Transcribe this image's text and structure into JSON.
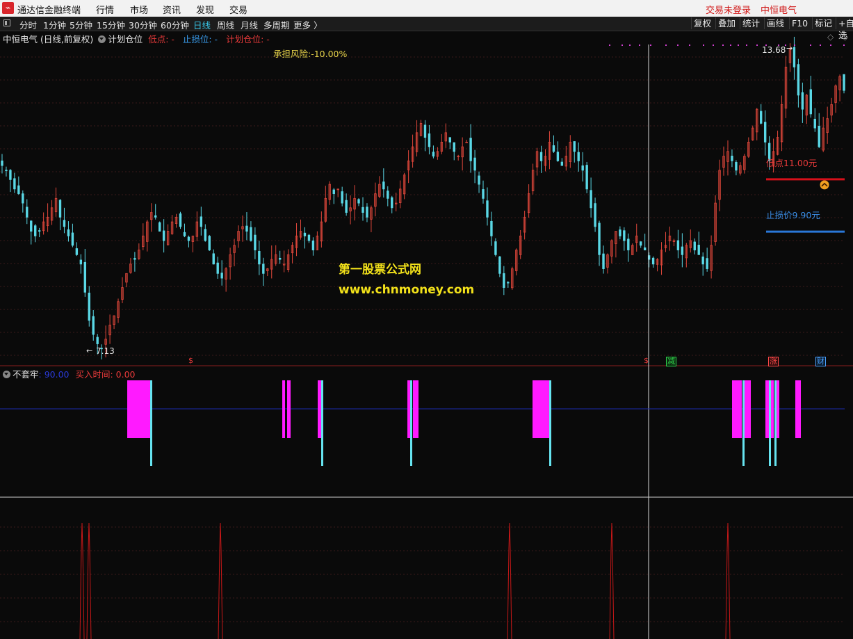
{
  "app": {
    "title": "通达信金融终端",
    "logo_icon": "tdx-logo-icon"
  },
  "menu": [
    "行情",
    "市场",
    "资讯",
    "发现",
    "交易"
  ],
  "menu_right": {
    "login_status": "交易未登录",
    "stock_name": "中恒电气"
  },
  "toolbar": {
    "periods": [
      "分时",
      "1分钟",
      "5分钟",
      "15分钟",
      "30分钟",
      "60分钟",
      "日线",
      "周线",
      "月线",
      "多周期",
      "更多 〉"
    ],
    "active_period": "日线",
    "right_buttons": [
      "复权",
      "叠加",
      "统计",
      "画线",
      "F10",
      "标记",
      "+自选"
    ]
  },
  "main_panel": {
    "title": "中恒电气 (日线,前复权)",
    "indicator": "计划仓位",
    "low_label": "低点: -",
    "stop_label": "止损位: -",
    "plan_label": "计划仓位: -",
    "risk_text": "承担风险:-10.00%",
    "low_marker": "低点11.00元",
    "stop_marker": "止损价9.90元",
    "high_price": "13.68",
    "low_price": "7.13",
    "watermark_name": "第一股票公式网",
    "watermark_url": "www.chnmoney.com",
    "markers": [
      "$",
      "$",
      "减",
      "涨",
      "财"
    ]
  },
  "sub_panel": {
    "indicator": "不套牢",
    "value_label": ": 90.00",
    "buy_label": "买入时间: 0.00"
  },
  "colors": {
    "up": "#e0473b",
    "down": "#5ad8e6",
    "magenta": "#ff1aff",
    "cyan_bar": "#66e4f0",
    "red_line": "#d8101a",
    "blue_line": "#2a78d8"
  },
  "chart_data": {
    "type": "candlestick",
    "price_range": [
      7.13,
      13.68
    ],
    "close_series": [
      11.1,
      11.0,
      10.8,
      10.6,
      10.5,
      10.3,
      10.0,
      9.7,
      9.6,
      9.7,
      9.9,
      10.0,
      10.2,
      10.4,
      10.0,
      9.8,
      9.6,
      9.4,
      9.2,
      9.0,
      8.4,
      7.8,
      7.5,
      7.3,
      7.2,
      7.4,
      7.7,
      7.9,
      8.2,
      8.5,
      8.8,
      9.0,
      9.1,
      9.3,
      9.6,
      9.9,
      10.1,
      10.0,
      9.7,
      9.5,
      9.7,
      9.9,
      10.0,
      9.8,
      9.6,
      9.5,
      9.6,
      9.9,
      9.8,
      9.5,
      9.3,
      9.0,
      8.8,
      8.7,
      8.9,
      9.2,
      9.4,
      9.7,
      9.8,
      9.7,
      9.5,
      9.3,
      9.0,
      8.8,
      8.9,
      9.1,
      9.2,
      9.1,
      9.0,
      9.2,
      9.4,
      9.6,
      9.7,
      9.6,
      9.5,
      9.3,
      9.6,
      9.9,
      10.4,
      10.7,
      10.5,
      10.6,
      10.3,
      10.1,
      10.2,
      10.4,
      10.3,
      10.1,
      10.0,
      10.2,
      10.5,
      10.7,
      10.6,
      10.4,
      10.2,
      10.3,
      10.6,
      10.9,
      11.2,
      11.5,
      11.8,
      12.0,
      11.7,
      11.5,
      11.3,
      11.4,
      11.6,
      11.8,
      11.6,
      11.4,
      11.3,
      11.5,
      11.6,
      11.2,
      11.0,
      10.7,
      10.4,
      10.0,
      9.6,
      9.2,
      8.8,
      8.5,
      8.6,
      8.9,
      9.3,
      9.6,
      10.0,
      10.5,
      11.0,
      11.4,
      11.2,
      11.3,
      11.6,
      11.4,
      11.2,
      11.1,
      11.3,
      11.6,
      11.4,
      11.2,
      11.0,
      10.6,
      10.2,
      9.8,
      9.2,
      8.9,
      9.2,
      9.5,
      9.7,
      9.6,
      9.5,
      9.3,
      9.4,
      9.6,
      9.4,
      9.3,
      9.1,
      9.0,
      9.1,
      9.3,
      9.4,
      9.6,
      9.5,
      9.3,
      9.2,
      9.4,
      9.5,
      9.3,
      9.2,
      9.0,
      8.9,
      9.4,
      10.3,
      11.0,
      11.3,
      11.4,
      11.2,
      11.0,
      11.1,
      11.3,
      11.6,
      11.9,
      12.3,
      12.0,
      11.6,
      11.2,
      11.4,
      11.7,
      12.4,
      13.2,
      13.6,
      13.2,
      12.6,
      12.3,
      12.6,
      12.2,
      11.9,
      11.5,
      11.9,
      12.1,
      12.4,
      12.8,
      13.0,
      12.7
    ]
  }
}
